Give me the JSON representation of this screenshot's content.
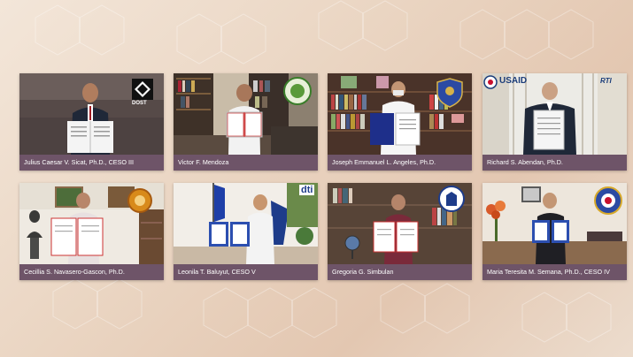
{
  "participants": [
    {
      "name": "Julius Caesar V. Sicat, Ph.D., CESO III",
      "logo_text": "DOST"
    },
    {
      "name": "Victor F. Mendoza",
      "logo_text": ""
    },
    {
      "name": "Joseph Emmanuel L. Angeles, Ph.D.",
      "logo_text": ""
    },
    {
      "name": "Richard S. Abendan, Ph.D.",
      "logo_text": "USAID",
      "logo_text_2": "RTI"
    },
    {
      "name": "Cecillia S. Navasero-Gascon, Ph.D.",
      "logo_text": ""
    },
    {
      "name": "Leonila T. Baluyut, CESO V",
      "logo_text": "dti"
    },
    {
      "name": "Gregoria G. Simbulan",
      "logo_text": ""
    },
    {
      "name": "Maria Teresita M. Semana, Ph.D., CESO IV",
      "logo_text": ""
    }
  ],
  "colors": {
    "caption_bg": "#6e5468",
    "background": "#ead5c2"
  }
}
